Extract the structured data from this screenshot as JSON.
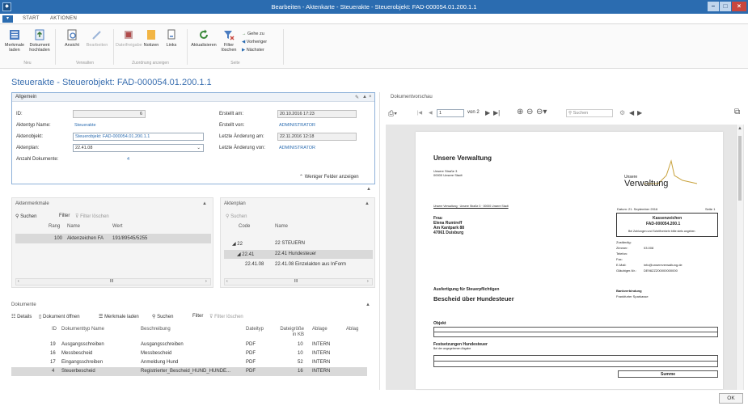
{
  "window": {
    "title": "Bearbeiten - Aktenkarte - Steuerakte - Steuerobjekt: FAD-000054.01.200.1.1"
  },
  "menu": {
    "tabs": [
      "START",
      "AKTIONEN"
    ]
  },
  "ribbon": {
    "merkmale_laden": "Merkmale laden",
    "dokument_hochladen": "Dokument hochladen",
    "group_neu": "Neu",
    "ansicht": "Ansicht",
    "bearbeiten": "Bearbeiten",
    "group_verwalten": "Verwalten",
    "dateifreigabe": "Dateifreigabe",
    "notizen": "Notizen",
    "links": "Links",
    "group_zuordnung": "Zuordnung anzeigen",
    "aktualisieren": "Aktualisieren",
    "filter_loeschen": "Filter löschen",
    "gehe_zu": "Gehe zu",
    "vorheriger": "Vorheriger",
    "naechster": "Nächster",
    "group_seite": "Seite"
  },
  "page_title": "Steuerakte - Steuerobjekt: FAD-000054.01.200.1.1",
  "allgemein": {
    "title": "Allgemein",
    "id_label": "ID:",
    "id_value": "6",
    "aktentyp_label": "Aktentyp Name:",
    "aktentyp_value": "Steuerakte",
    "aktenobjekt_label": "Aktenobjekt:",
    "aktenobjekt_value": "Steuerobjekt: FAD-000054.01.200.1.1",
    "aktenplan_label": "Aktenplan:",
    "aktenplan_value": "22.41.08",
    "anzahl_label": "Anzahl Dokumente:",
    "anzahl_value": "4",
    "erstellt_am_label": "Erstellt am:",
    "erstellt_am_value": "20.10.2016 17:23",
    "erstellt_von_label": "Erstellt von:",
    "erstellt_von_value": "ADMINISTRATOR",
    "letzte_am_label": "Letzte Änderung am:",
    "letzte_am_value": "22.11.2016 12:18",
    "letzte_von_label": "Letzte Änderung von:",
    "letzte_von_value": "ADMINISTRATOR",
    "weniger": "Weniger Felder anzeigen"
  },
  "aktenmerkmale": {
    "title": "Aktenmerkmale",
    "suchen": "Suchen",
    "filter": "Filter",
    "filter_loeschen": "Filter löschen",
    "columns": [
      "Rang",
      "Name",
      "Wert"
    ],
    "rows": [
      {
        "rang": "100",
        "name": "Aktenzeichen FA",
        "wert": "191/89545/5255"
      }
    ]
  },
  "aktenplan": {
    "title": "Aktenplan",
    "suchen": "Suchen",
    "columns": [
      "Code",
      "Name"
    ],
    "rows": [
      {
        "code": "22",
        "name": "22 STEUERN"
      },
      {
        "code": "22.41",
        "name": "22.41 Hundesteuer"
      },
      {
        "code": "22.41.08",
        "name": "22.41.08 Einzelakten aus InForm"
      }
    ]
  },
  "dokumente": {
    "title": "Dokumente",
    "toolbar": {
      "details": "Details",
      "dokument_oeffnen": "Dokument öffnen",
      "merkmale_laden": "Merkmale laden",
      "suchen": "Suchen",
      "filter": "Filter",
      "filter_loeschen": "Filter löschen"
    },
    "columns": [
      "ID",
      "Dokumenttyp Name",
      "Beschreibung",
      "Dateityp",
      "Dateigröße in KB",
      "Ablage",
      "Ablag"
    ],
    "rows": [
      {
        "id": "19",
        "typ": "Ausgangsschreiben",
        "beschreibung": "Ausgangsschreiben",
        "dateityp": "PDF",
        "groesse": "10",
        "ablage": "INTERN"
      },
      {
        "id": "16",
        "typ": "Messbescheid",
        "beschreibung": "Messbescheid",
        "dateityp": "PDF",
        "groesse": "10",
        "ablage": "INTERN"
      },
      {
        "id": "17",
        "typ": "Eingangsschreiben",
        "beschreibung": "Anmeldung Hund",
        "dateityp": "PDF",
        "groesse": "52",
        "ablage": "INTERN"
      },
      {
        "id": "4",
        "typ": "Steuerbescheid",
        "beschreibung": "Registrierter_Bescheid_HUND_HUNDE...",
        "dateityp": "PDF",
        "groesse": "16",
        "ablage": "INTERN"
      }
    ]
  },
  "vorschau": {
    "title": "Dokumentvorschau",
    "page_value": "1",
    "page_of": "von 2",
    "suchen_placeholder": "Suchen"
  },
  "document": {
    "header": "Unsere Verwaltung",
    "address_small_1": "Unsere Straße 3",
    "address_small_2": "00000 Unsere Stadt",
    "logo_small": "Unsere",
    "logo_big": "Verwaltung",
    "sender_line": "Unsere Verwaltung · Unsere Straße 3 · 00000 Unsere Stadt",
    "recipient": [
      "Frau",
      "Elena Rumireff",
      "Am Kantpark 88",
      "47061 Duisburg"
    ],
    "datum": "Datum: 21. September 2016",
    "seite": "Seite 1",
    "kassen_title": "Kassenzeichen",
    "kassen_value": "FAD-000054.200.1",
    "kassen_note": "Bei Zahlungen und Schriftverkehr bitte stets angeben",
    "contact": [
      "Zuständig:",
      "Zimmer:",
      "Telefon:",
      "Fax:",
      "E-Mail:",
      "Gläubiger-Nr.:"
    ],
    "contact_values": [
      "",
      "03.008",
      "",
      "",
      "info@unsereverwaltung.de",
      "DE98ZZZ00000000000"
    ],
    "auffo": "Ausfertigung für Steuerpflichtigen",
    "bescheid": "Bescheid über Hundesteuer",
    "bank_title": "Bankverbindung",
    "bank_value": "Frankfurter Sparkasse",
    "objekt": "Objekt",
    "festsetzung": "Festsetzungen Hundesteuer",
    "festsetzung_sub": "Bei der angegebenen Abgabe",
    "summe": "Summe"
  },
  "footer": {
    "ok": "OK"
  }
}
